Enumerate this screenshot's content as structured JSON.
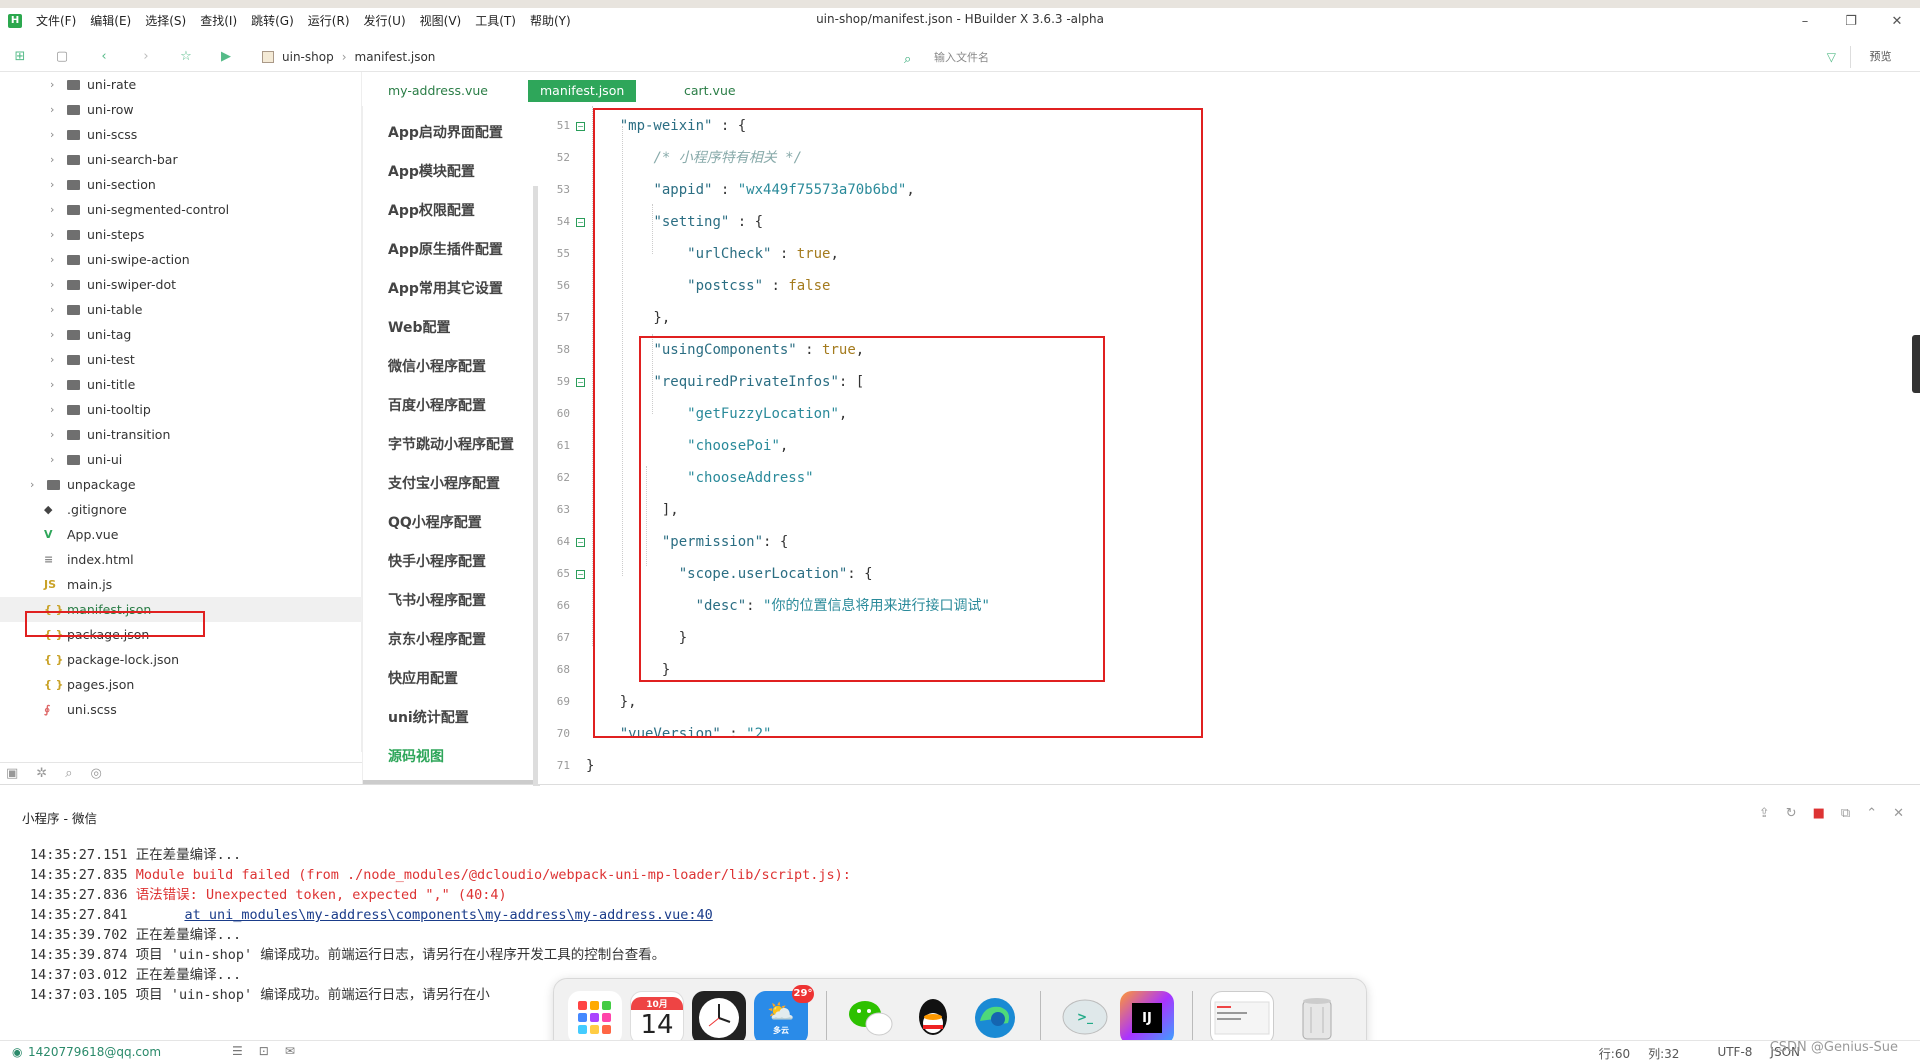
{
  "window": {
    "title": "uin-shop/manifest.json - HBuilder X 3.6.3 -alpha",
    "menu": [
      "文件(F)",
      "编辑(E)",
      "选择(S)",
      "查找(I)",
      "跳转(G)",
      "运行(R)",
      "发行(U)",
      "视图(V)",
      "工具(T)",
      "帮助(Y)"
    ],
    "controls": [
      "–",
      "❐",
      "✕"
    ]
  },
  "toolbar": {
    "breadcrumb_project": "uin-shop",
    "breadcrumb_file": "manifest.json",
    "file_search_placeholder": "输入文件名",
    "preview_label": "预览"
  },
  "sidebar": {
    "items": [
      {
        "label": "uni-rate",
        "type": "folder",
        "indent": 2
      },
      {
        "label": "uni-row",
        "type": "folder",
        "indent": 2
      },
      {
        "label": "uni-scss",
        "type": "folder",
        "indent": 2
      },
      {
        "label": "uni-search-bar",
        "type": "folder",
        "indent": 2
      },
      {
        "label": "uni-section",
        "type": "folder",
        "indent": 2
      },
      {
        "label": "uni-segmented-control",
        "type": "folder",
        "indent": 2
      },
      {
        "label": "uni-steps",
        "type": "folder",
        "indent": 2
      },
      {
        "label": "uni-swipe-action",
        "type": "folder",
        "indent": 2
      },
      {
        "label": "uni-swiper-dot",
        "type": "folder",
        "indent": 2
      },
      {
        "label": "uni-table",
        "type": "folder",
        "indent": 2
      },
      {
        "label": "uni-tag",
        "type": "folder",
        "indent": 2
      },
      {
        "label": "uni-test",
        "type": "folder",
        "indent": 2
      },
      {
        "label": "uni-title",
        "type": "folder",
        "indent": 2
      },
      {
        "label": "uni-tooltip",
        "type": "folder",
        "indent": 2
      },
      {
        "label": "uni-transition",
        "type": "folder",
        "indent": 2
      },
      {
        "label": "uni-ui",
        "type": "folder",
        "indent": 2
      },
      {
        "label": "unpackage",
        "type": "folder",
        "indent": 1
      },
      {
        "label": ".gitignore",
        "type": "git",
        "indent": 1
      },
      {
        "label": "App.vue",
        "type": "vue",
        "indent": 1
      },
      {
        "label": "index.html",
        "type": "html",
        "indent": 1
      },
      {
        "label": "main.js",
        "type": "js",
        "indent": 1
      },
      {
        "label": "manifest.json",
        "type": "json",
        "indent": 1,
        "selected": true
      },
      {
        "label": "package.json",
        "type": "json",
        "indent": 1
      },
      {
        "label": "package-lock.json",
        "type": "json",
        "indent": 1
      },
      {
        "label": "pages.json",
        "type": "json",
        "indent": 1
      },
      {
        "label": "uni.scss",
        "type": "scss",
        "indent": 1
      }
    ]
  },
  "tabs": [
    {
      "label": "my-address.vue"
    },
    {
      "label": "manifest.json",
      "active": true
    },
    {
      "label": "cart.vue"
    }
  ],
  "config_menu": [
    "App启动界面配置",
    "App模块配置",
    "App权限配置",
    "App原生插件配置",
    "App常用其它设置",
    "Web配置",
    "微信小程序配置",
    "百度小程序配置",
    "字节跳动小程序配置",
    "支付宝小程序配置",
    "QQ小程序配置",
    "快手小程序配置",
    "飞书小程序配置",
    "京东小程序配置",
    "快应用配置",
    "uni统计配置",
    "源码视图"
  ],
  "code": {
    "lines": [
      {
        "n": "51",
        "fold": true,
        "tokens": [
          [
            "p",
            "    "
          ],
          [
            "k",
            "\"mp-weixin\""
          ],
          [
            "p",
            " : {"
          ]
        ]
      },
      {
        "n": "52",
        "tokens": [
          [
            "p",
            "        "
          ],
          [
            "c",
            "/* 小程序特有相关 */"
          ]
        ]
      },
      {
        "n": "53",
        "tokens": [
          [
            "p",
            "        "
          ],
          [
            "k",
            "\"appid\""
          ],
          [
            "p",
            " : "
          ],
          [
            "s",
            "\"wx449f75573a70b6bd\""
          ],
          [
            "p",
            ","
          ]
        ]
      },
      {
        "n": "54",
        "fold": true,
        "tokens": [
          [
            "p",
            "        "
          ],
          [
            "k",
            "\"setting\""
          ],
          [
            "p",
            " : {"
          ]
        ]
      },
      {
        "n": "55",
        "tokens": [
          [
            "p",
            "            "
          ],
          [
            "k",
            "\"urlCheck\""
          ],
          [
            "p",
            " : "
          ],
          [
            "b",
            "true"
          ],
          [
            "p",
            ","
          ]
        ]
      },
      {
        "n": "56",
        "tokens": [
          [
            "p",
            "            "
          ],
          [
            "k",
            "\"postcss\""
          ],
          [
            "p",
            " : "
          ],
          [
            "b",
            "false"
          ]
        ]
      },
      {
        "n": "57",
        "tokens": [
          [
            "p",
            "        },"
          ]
        ]
      },
      {
        "n": "58",
        "tokens": [
          [
            "p",
            "        "
          ],
          [
            "k",
            "\"usingComponents\""
          ],
          [
            "p",
            " : "
          ],
          [
            "b",
            "true"
          ],
          [
            "p",
            ","
          ]
        ]
      },
      {
        "n": "59",
        "fold": true,
        "tokens": [
          [
            "p",
            "        "
          ],
          [
            "k",
            "\"requiredPrivateInfos\""
          ],
          [
            "p",
            ": ["
          ]
        ]
      },
      {
        "n": "60",
        "tokens": [
          [
            "p",
            "            "
          ],
          [
            "s",
            "\"getFuzzyLocation\""
          ],
          [
            "p",
            ","
          ]
        ]
      },
      {
        "n": "61",
        "tokens": [
          [
            "p",
            "            "
          ],
          [
            "s",
            "\"choosePoi\""
          ],
          [
            "p",
            ","
          ]
        ]
      },
      {
        "n": "62",
        "tokens": [
          [
            "p",
            "            "
          ],
          [
            "s",
            "\"chooseAddress\""
          ]
        ]
      },
      {
        "n": "63",
        "tokens": [
          [
            "p",
            "         ],"
          ]
        ]
      },
      {
        "n": "64",
        "fold": true,
        "tokens": [
          [
            "p",
            "         "
          ],
          [
            "k",
            "\"permission\""
          ],
          [
            "p",
            ": {"
          ]
        ]
      },
      {
        "n": "65",
        "fold": true,
        "tokens": [
          [
            "p",
            "           "
          ],
          [
            "k",
            "\"scope.userLocation\""
          ],
          [
            "p",
            ": {"
          ]
        ]
      },
      {
        "n": "66",
        "tokens": [
          [
            "p",
            "             "
          ],
          [
            "k",
            "\"desc\""
          ],
          [
            "p",
            ": "
          ],
          [
            "s",
            "\"你的位置信息将用来进行接口调试\""
          ]
        ]
      },
      {
        "n": "67",
        "tokens": [
          [
            "p",
            "           }"
          ]
        ]
      },
      {
        "n": "68",
        "tokens": [
          [
            "p",
            "         }"
          ]
        ]
      },
      {
        "n": "69",
        "tokens": [
          [
            "p",
            "    },"
          ]
        ]
      },
      {
        "n": "70",
        "tokens": [
          [
            "p",
            "    "
          ],
          [
            "k",
            "\"vueVersion\""
          ],
          [
            "p",
            " : "
          ],
          [
            "s",
            "\"2\""
          ]
        ]
      },
      {
        "n": "71",
        "tokens": [
          [
            "p",
            "}"
          ]
        ]
      }
    ]
  },
  "console": {
    "title": "小程序 - 微信",
    "logs": [
      {
        "time": "14:35:27.151",
        "text": "正在差量编译...",
        "style": "normal"
      },
      {
        "time": "14:35:27.835",
        "text": "Module build failed (from ./node_modules/@dcloudio/webpack-uni-mp-loader/lib/script.js):",
        "style": "err"
      },
      {
        "time": "14:35:27.836",
        "text": "语法错误: Unexpected token, expected \",\" (40:4)",
        "style": "err"
      },
      {
        "time": "14:35:27.841",
        "text": "at uni_modules\\my-address\\components\\my-address\\my-address.vue:40",
        "style": "link"
      },
      {
        "time": "14:35:39.702",
        "text": "正在差量编译...",
        "style": "normal"
      },
      {
        "time": "14:35:39.874",
        "text": "项目 'uin-shop' 编译成功。前端运行日志，请另行在小程序开发工具的控制台查看。",
        "style": "normal"
      },
      {
        "time": "14:37:03.012",
        "text": "正在差量编译...",
        "style": "normal"
      },
      {
        "time": "14:37:03.105",
        "text": "项目 'uin-shop' 编译成功。前端运行日志，请另行在小",
        "style": "normal"
      }
    ]
  },
  "status": {
    "user": "1420779618@qq.com",
    "line": "行:60",
    "col": "列:32",
    "encoding": "UTF-8",
    "lang": "JSON"
  },
  "watermark": "CSDN @Genius-Sue",
  "dock": {
    "calendar_month": "10月",
    "calendar_day": "14",
    "weather_temp": "29°",
    "weather_label": "多云"
  },
  "colors": {
    "accent": "#2ea65a",
    "highlight_box": "#e02020",
    "error_text": "#d33333"
  }
}
